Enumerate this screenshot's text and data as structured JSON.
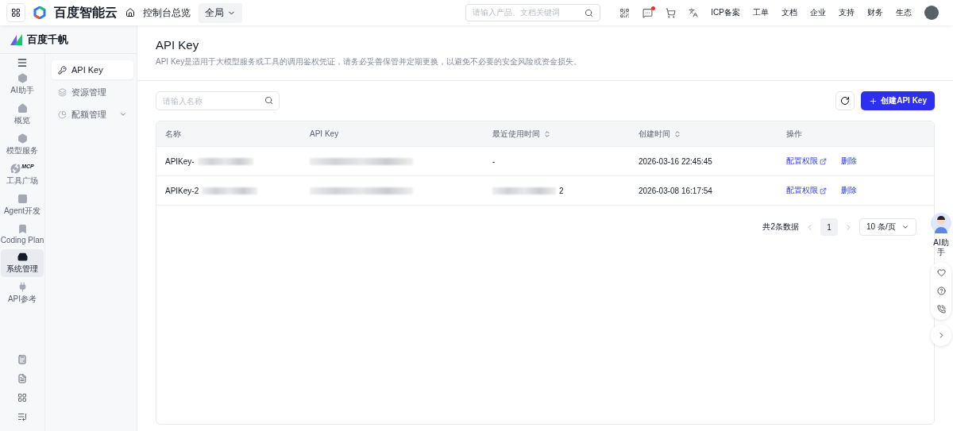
{
  "topbar": {
    "brand": "百度智能云",
    "console": "控制台总览",
    "region": "全局",
    "search_placeholder": "请输入产品、文档关键词",
    "links": [
      "ICP备案",
      "工单",
      "文档",
      "企业",
      "支持",
      "财务",
      "生态"
    ],
    "has_message_dot": true
  },
  "product": {
    "name": "百度千帆"
  },
  "rail": [
    {
      "label": "AI助手",
      "selected": false
    },
    {
      "label": "概览",
      "selected": false
    },
    {
      "label": "模型服务",
      "selected": false
    },
    {
      "label": "工具广场",
      "badge": "MCP",
      "selected": false
    },
    {
      "label": "Agent开发",
      "selected": false
    },
    {
      "label": "Coding Plan",
      "selected": false
    },
    {
      "label": "系统管理",
      "selected": true
    },
    {
      "label": "API参考",
      "selected": false
    }
  ],
  "submenu": [
    {
      "label": "API Key",
      "selected": true,
      "expandable": false
    },
    {
      "label": "资源管理",
      "selected": false,
      "expandable": false
    },
    {
      "label": "配额管理",
      "selected": false,
      "expandable": true
    }
  ],
  "page": {
    "title": "API Key",
    "description": "API Key是适用于大模型服务或工具的调用鉴权凭证，请务必妥善保管并定期更换，以避免不必要的安全风险或资金损失。"
  },
  "toolbar": {
    "search_placeholder": "请输入名称",
    "create_button": "创建API Key"
  },
  "table": {
    "columns": [
      {
        "label": "名称",
        "sortable": false
      },
      {
        "label": "API Key",
        "sortable": false
      },
      {
        "label": "最近使用时间",
        "sortable": true
      },
      {
        "label": "创建时间",
        "sortable": true
      },
      {
        "label": "操作",
        "sortable": false
      }
    ],
    "rows": [
      {
        "name": "APIKey-",
        "last_used": "-",
        "last_used_redacted": false,
        "created": "2026-03-16 22:45:45",
        "actions": [
          "配置权限",
          "删除"
        ]
      },
      {
        "name": "APIKey-2",
        "last_used": "2",
        "last_used_redacted": true,
        "created": "2026-03-08 16:17:54",
        "actions": [
          "配置权限",
          "删除"
        ]
      }
    ]
  },
  "pagination": {
    "total": "共2条数据",
    "pages": [
      {
        "label": "1",
        "selected": true
      }
    ],
    "page_size": "10 条/页"
  },
  "assistant": {
    "label": "AI助手"
  }
}
